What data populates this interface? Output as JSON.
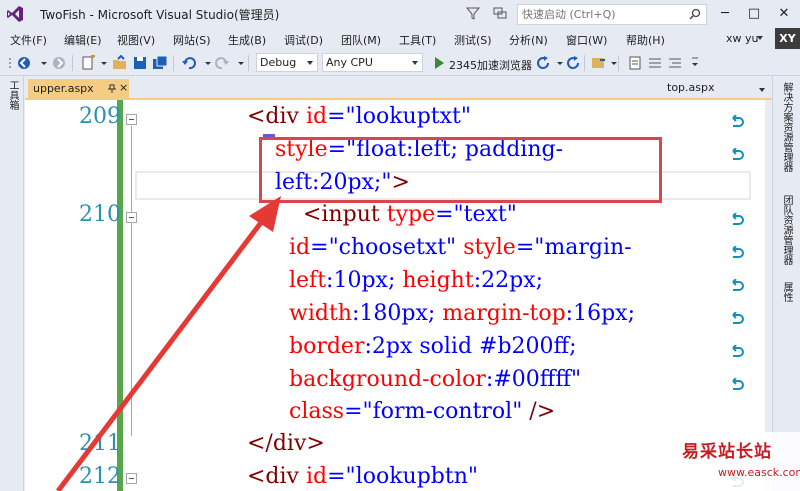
{
  "window": {
    "title": "TwoFish - Microsoft Visual Studio(管理员)",
    "quick_launch_placeholder": "快速启动 (Ctrl+Q)",
    "minimize": "─",
    "maximize": "□",
    "close": "✕"
  },
  "menu": {
    "items": [
      "文件(F)",
      "编辑(E)",
      "视图(V)",
      "网站(S)",
      "生成(B)",
      "调试(D)",
      "团队(M)",
      "工具(T)",
      "测试(S)",
      "分析(N)",
      "窗口(W)",
      "帮助(H)"
    ],
    "user": "xw yu",
    "avatar_initials": "XY"
  },
  "toolbar": {
    "config": "Debug",
    "platform": "Any CPU",
    "run_target": "2345加速浏览器"
  },
  "left_panel": {
    "toolbox_label": "工具箱"
  },
  "right_panel": {
    "tabs": [
      "解决方案资源管理器",
      "团队资源管理器",
      "属性"
    ]
  },
  "tabs": {
    "active": "upper.aspx",
    "inactive": "top.aspx",
    "close_glyph": "×"
  },
  "editor": {
    "line_numbers": [
      "209",
      "210",
      "211",
      "212"
    ],
    "lines": {
      "l209_tag": "<div ",
      "l209_attr": "id",
      "l209_eq": "=",
      "l209_val": "\"lookuptxt\"",
      "l209b_attr": "style",
      "l209b_eq": "=",
      "l209b_val": "\"float:left; padding-",
      "l209c_val": "left:20px;\"",
      "l209c_end": ">",
      "l210_tag": "<input ",
      "l210_attr": "type",
      "l210_eq": "=",
      "l210_val": "\"text\"",
      "l210b_attr1": "id",
      "l210b_eq1": "=",
      "l210b_val1": "\"choosetxt\" ",
      "l210b_attr2": "style",
      "l210b_eq2": "=",
      "l210b_val2": "\"margin-",
      "l210c_attr1": "left",
      "l210c_pun1": ":10px; ",
      "l210c_attr2": "height",
      "l210c_pun2": ":22px;",
      "l210d_attr1": "width",
      "l210d_pun1": ":180px; ",
      "l210d_attr2": "margin-top",
      "l210d_pun2": ":16px;",
      "l210e_attr1": "border",
      "l210e_pun1": ":2px solid #b200ff;",
      "l210f_attr1": "background-color",
      "l210f_pun1": ":#00ffff\"",
      "l210g_attr1": "class",
      "l210g_eq": "=",
      "l210g_val": "\"form-control\"",
      "l210g_end": " />",
      "l211_tag": "</div>",
      "l212_tag": "<div ",
      "l212_attr": "id",
      "l212_eq": "=",
      "l212_val": "\"lookupbtn\""
    }
  },
  "watermark": {
    "title": "易采站长站",
    "url": "www.easck.com"
  },
  "colors": {
    "tag": "#800000",
    "attribute": "#ff0000",
    "value": "#0000ff",
    "line_number": "#2b91af",
    "annotation": "#d9474c",
    "active_tab": "#f5cc84"
  }
}
